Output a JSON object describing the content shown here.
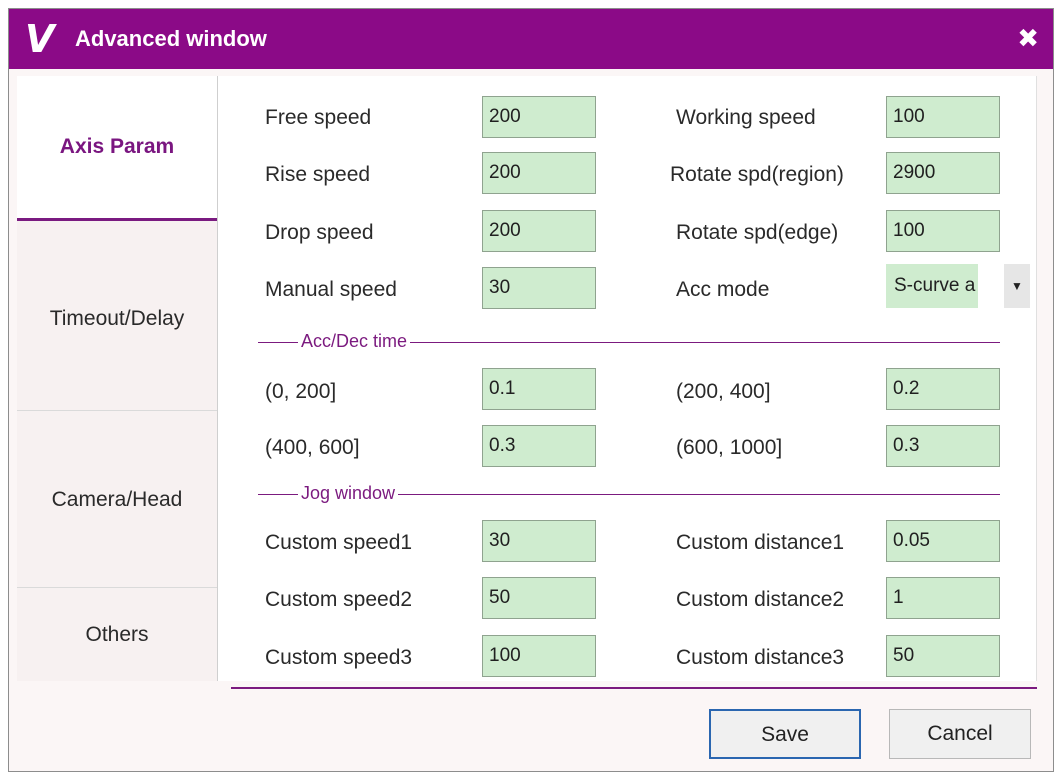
{
  "window": {
    "title": "Advanced window",
    "logo": "V",
    "close_glyph": "✖"
  },
  "tabs": [
    {
      "label": "Axis Param",
      "active": true
    },
    {
      "label": "Timeout/Delay",
      "active": false
    },
    {
      "label": "Camera/Head",
      "active": false
    },
    {
      "label": "Others",
      "active": false
    }
  ],
  "params": {
    "free_speed": {
      "label": "Free speed",
      "value": "200"
    },
    "rise_speed": {
      "label": "Rise speed",
      "value": "200"
    },
    "drop_speed": {
      "label": "Drop speed",
      "value": "200"
    },
    "manual_speed": {
      "label": "Manual speed",
      "value": "30"
    },
    "working_speed": {
      "label": "Working speed",
      "value": "100"
    },
    "rotate_region": {
      "label": "Rotate spd(region)",
      "value": "2900"
    },
    "rotate_edge": {
      "label": "Rotate spd(edge)",
      "value": "100"
    },
    "acc_mode": {
      "label": "Acc mode",
      "value": "S-curve a",
      "arrow": "▼"
    }
  },
  "acc_dec": {
    "title": "Acc/Dec time",
    "r1": {
      "label": "(0, 200]",
      "value": "0.1"
    },
    "r2": {
      "label": "(200, 400]",
      "value": "0.2"
    },
    "r3": {
      "label": "(400, 600]",
      "value": "0.3"
    },
    "r4": {
      "label": "(600, 1000]",
      "value": "0.3"
    }
  },
  "jog": {
    "title": "Jog window",
    "speed1": {
      "label": "Custom speed1",
      "value": "30"
    },
    "speed2": {
      "label": "Custom speed2",
      "value": "50"
    },
    "speed3": {
      "label": "Custom speed3",
      "value": "100"
    },
    "dist1": {
      "label": "Custom distance1",
      "value": "0.05"
    },
    "dist2": {
      "label": "Custom distance2",
      "value": "1"
    },
    "dist3": {
      "label": "Custom distance3",
      "value": "50"
    }
  },
  "buttons": {
    "save": "Save",
    "cancel": "Cancel"
  },
  "colors": {
    "titlebar": "#8b0a87",
    "accent": "#7b1a7f",
    "field_bg": "#cfeccf"
  }
}
